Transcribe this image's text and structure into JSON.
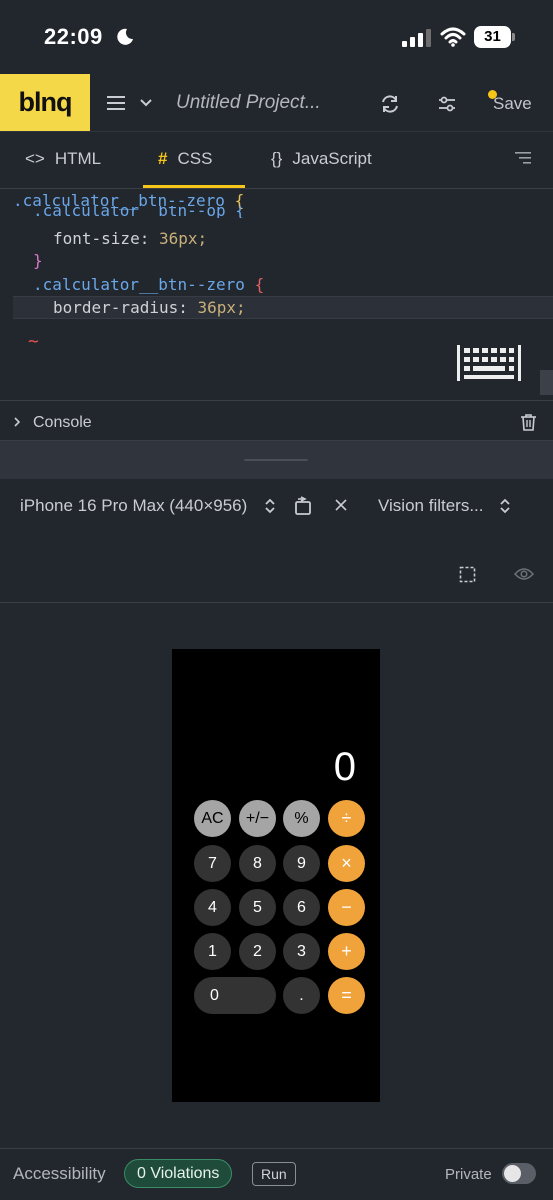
{
  "status_bar": {
    "time": "22:09",
    "battery": "31"
  },
  "header": {
    "logo": "blnq",
    "project_title": "Untitled Project...",
    "save_label": "Save"
  },
  "tabs": [
    {
      "glyph": "<>",
      "label": "HTML"
    },
    {
      "glyph": "#",
      "label": "CSS"
    },
    {
      "glyph": "{}",
      "label": "JavaScript"
    }
  ],
  "editor": {
    "sticky_selector": ".calculator__btn--zero",
    "sticky_brace": "{",
    "line_partial": ".calculator__btn--op {",
    "line_font_prop": "font-size:",
    "line_font_value": "36px;",
    "line_close": "}",
    "line_zero_selector": ".calculator__btn--zero",
    "line_zero_brace": "{",
    "line_br_prop": "border-radius:",
    "line_br_value": "36px;",
    "squiggle": "~"
  },
  "console": {
    "label": "Console"
  },
  "preview": {
    "device": "iPhone 16 Pro Max (440×956)",
    "vision_filters": "Vision filters..."
  },
  "calculator": {
    "display": "0",
    "buttons": [
      "AC",
      "+/−",
      "%",
      "÷",
      "7",
      "8",
      "9",
      "×",
      "4",
      "5",
      "6",
      "−",
      "1",
      "2",
      "3",
      "+",
      "0",
      ".",
      "="
    ]
  },
  "colors": {
    "accent": "#f5d848",
    "operator": "#f1a33b",
    "function_key": "#a5a5a5",
    "number_key": "#333333"
  },
  "footer": {
    "accessibility": "Accessibility",
    "violations": "0 Violations",
    "run": "Run",
    "private": "Private"
  }
}
